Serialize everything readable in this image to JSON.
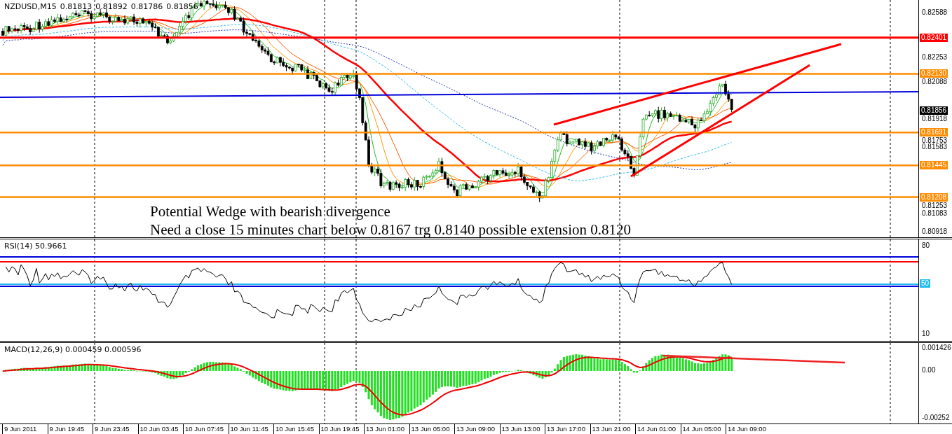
{
  "chart_header": {
    "symbol": "NZDUSD,M15",
    "quotes": [
      "0.81813",
      "0.81892",
      "0.81786",
      "0.81856"
    ]
  },
  "price_axis": {
    "ticks": [
      "0.82588",
      "0.82253",
      "0.82088",
      "0.81918",
      "0.81753",
      "0.81583",
      "0.81253",
      "0.81083",
      "0.80918"
    ]
  },
  "levels": [
    {
      "price": "0.82401",
      "color": "#ff0000"
    },
    {
      "price": "0.82130",
      "color": "#ff8c00"
    },
    {
      "price": "0.81691",
      "color": "#ff8c00"
    },
    {
      "price": "0.81445",
      "color": "#ff8c00"
    },
    {
      "price": "0.81208",
      "color": "#ff8c00"
    }
  ],
  "current_price": "0.81856",
  "annotation": [
    "Potential Wedge with bearish divergence",
    "Need a close 15 minutes chart below 0.8167 trg 0.8140 possible extension 0.8120"
  ],
  "rsi": {
    "label": "RSI(14) 50.9661",
    "ticks": [
      "80",
      "10"
    ],
    "level_badge": "50"
  },
  "macd": {
    "label": "MACD(12,26,9) 0.000459 0.000596",
    "ticks": [
      "0.001426",
      "0.00",
      "-0.00252"
    ]
  },
  "time_axis": [
    "9 Jun 2011",
    "9 Jun 19:45",
    "9 Jun 23:45",
    "10 Jun 03:45",
    "10 Jun 07:45",
    "10 Jun 11:45",
    "10 Jun 15:45",
    "10 Jun 19:45",
    "13 Jun 01:00",
    "13 Jun 05:00",
    "13 Jun 09:00",
    "13 Jun 13:00",
    "13 Jun 17:00",
    "13 Jun 21:00",
    "14 Jun 01:00",
    "14 Jun 05:00",
    "14 Jun 09:00"
  ]
}
